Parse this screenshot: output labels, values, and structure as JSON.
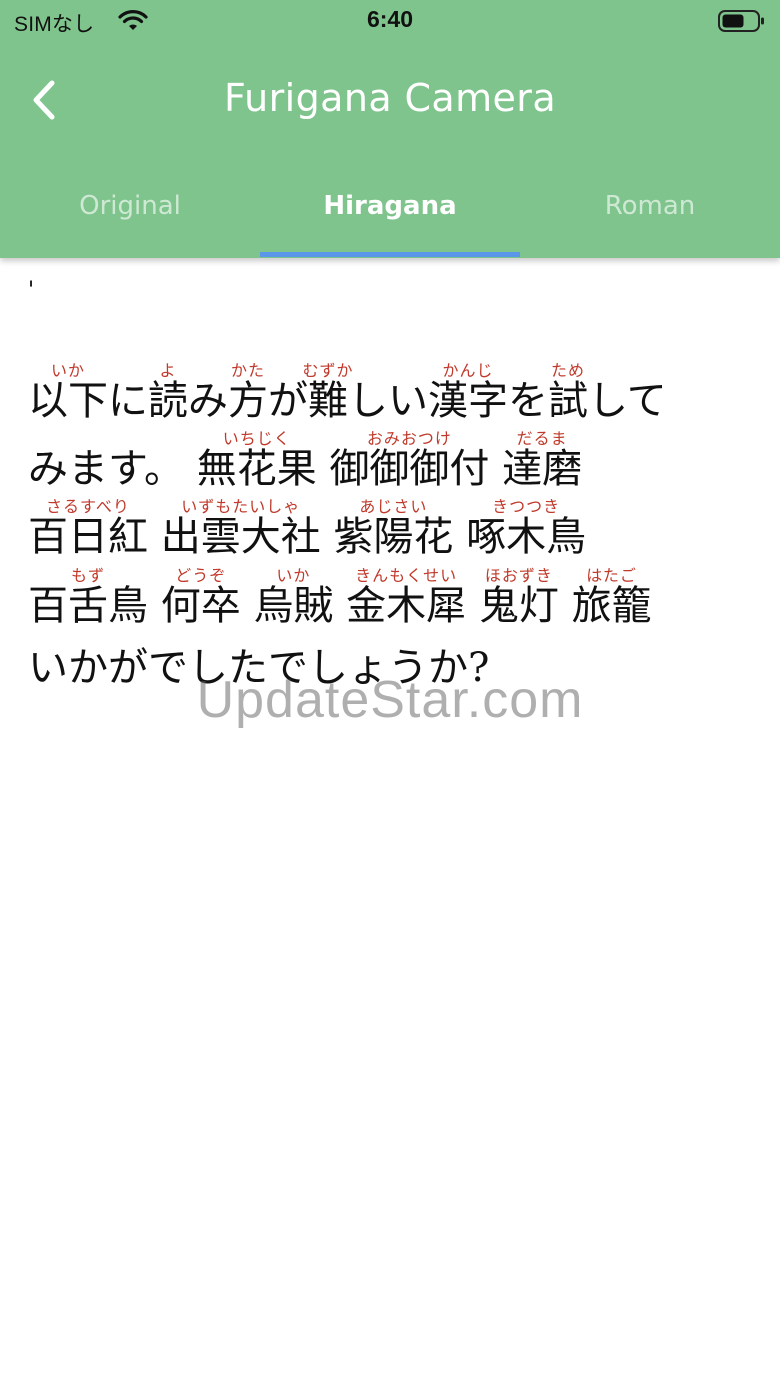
{
  "status_bar": {
    "carrier": "SIMなし",
    "time": "6:40",
    "wifi_icon": "wifi-icon",
    "battery_icon": "battery-icon"
  },
  "app_bar": {
    "title": "Furigana Camera",
    "back_icon": "chevron-left-icon",
    "color": "#7fc48c"
  },
  "tabs": {
    "items": [
      {
        "label": "Original"
      },
      {
        "label": "Hiragana"
      },
      {
        "label": "Roman"
      }
    ],
    "active": "Hiragana",
    "indicator_color": "#5b97e9"
  },
  "content": {
    "stray_mark": "'",
    "lines": [
      [
        {
          "t": "以下",
          "r": "いか"
        },
        {
          "t": "に"
        },
        {
          "t": "読",
          "r": "よ"
        },
        {
          "t": "み"
        },
        {
          "t": "方",
          "r": "かた"
        },
        {
          "t": "が"
        },
        {
          "t": "難",
          "r": "むずか"
        },
        {
          "t": "しい"
        },
        {
          "t": "漢字",
          "r": "かんじ"
        },
        {
          "t": "を"
        },
        {
          "t": "試",
          "r": "ため"
        },
        {
          "t": "して"
        }
      ],
      [
        {
          "t": "みます。 "
        },
        {
          "t": "無花果",
          "r": "いちじく"
        },
        {
          "t": " "
        },
        {
          "t": "御御御付",
          "r": "おみおつけ"
        },
        {
          "t": " "
        },
        {
          "t": "達磨",
          "r": "だるま"
        }
      ],
      [
        {
          "t": "百日紅",
          "r": "さるすべり"
        },
        {
          "t": " "
        },
        {
          "t": "出雲大社",
          "r": "いずもたいしゃ"
        },
        {
          "t": " "
        },
        {
          "t": "紫陽花",
          "r": "あじさい"
        },
        {
          "t": " "
        },
        {
          "t": "啄木鳥",
          "r": "きつつき"
        }
      ],
      [
        {
          "t": "百舌鳥",
          "r": "もず"
        },
        {
          "t": " "
        },
        {
          "t": "何卒",
          "r": "どうぞ"
        },
        {
          "t": " "
        },
        {
          "t": "烏賊",
          "r": "いか"
        },
        {
          "t": " "
        },
        {
          "t": "金木犀",
          "r": "きんもくせい"
        },
        {
          "t": " "
        },
        {
          "t": "鬼灯",
          "r": "ほおずき"
        },
        {
          "t": " "
        },
        {
          "t": "旅籠",
          "r": "はたご"
        }
      ],
      [
        {
          "t": "いかがでしたでしょうか?"
        }
      ]
    ],
    "furigana_color": "#c0392b"
  },
  "watermark": "UpdateStar.com"
}
